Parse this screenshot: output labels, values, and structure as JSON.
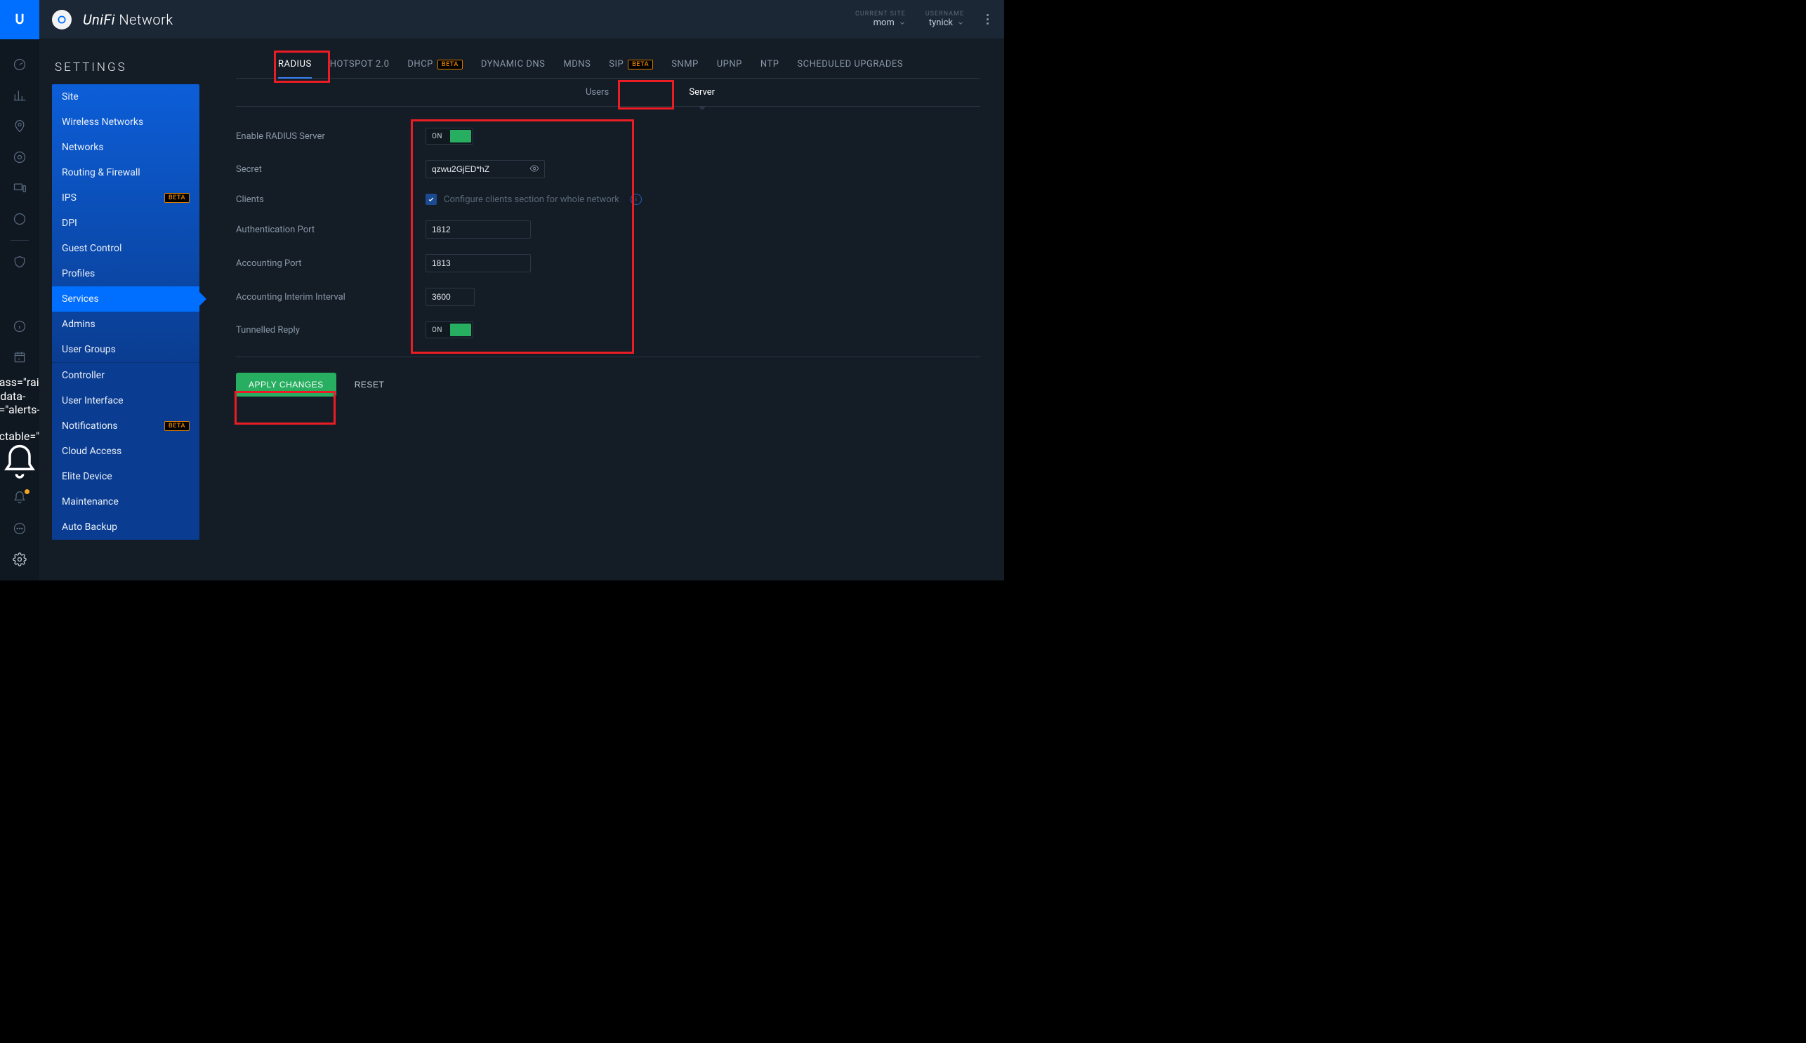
{
  "header": {
    "brand_prefix": "UniFi",
    "brand_suffix": " Network",
    "current_site_label": "CURRENT SITE",
    "current_site_value": "mom",
    "username_label": "USERNAME",
    "username_value": "tynick"
  },
  "sidebar": {
    "title": "SETTINGS",
    "group_top": [
      {
        "label": "Site"
      },
      {
        "label": "Wireless Networks"
      },
      {
        "label": "Networks"
      },
      {
        "label": "Routing & Firewall"
      },
      {
        "label": "IPS",
        "beta": "BETA"
      },
      {
        "label": "DPI"
      },
      {
        "label": "Guest Control"
      },
      {
        "label": "Profiles"
      },
      {
        "label": "Services",
        "active": true
      },
      {
        "label": "Admins"
      },
      {
        "label": "User Groups"
      }
    ],
    "group_bottom": [
      {
        "label": "Controller"
      },
      {
        "label": "User Interface"
      },
      {
        "label": "Notifications",
        "beta": "BETA"
      },
      {
        "label": "Cloud Access"
      },
      {
        "label": "Elite Device"
      },
      {
        "label": "Maintenance"
      },
      {
        "label": "Auto Backup"
      }
    ]
  },
  "tabs": {
    "top": [
      {
        "label": "RADIUS",
        "active": true
      },
      {
        "label": "HOTSPOT 2.0"
      },
      {
        "label": "DHCP",
        "beta": "BETA"
      },
      {
        "label": "DYNAMIC DNS"
      },
      {
        "label": "MDNS"
      },
      {
        "label": "SIP",
        "beta": "BETA"
      },
      {
        "label": "SNMP"
      },
      {
        "label": "UPNP"
      },
      {
        "label": "NTP"
      },
      {
        "label": "SCHEDULED UPGRADES"
      }
    ],
    "sub": [
      {
        "label": "Users"
      },
      {
        "label": "Server",
        "active": true
      }
    ]
  },
  "form": {
    "enable_label": "Enable RADIUS Server",
    "enable_toggle": "ON",
    "secret_label": "Secret",
    "secret_value": "qzwu2GjED*hZ",
    "clients_label": "Clients",
    "clients_checkbox_text": "Configure clients section for whole network",
    "auth_port_label": "Authentication Port",
    "auth_port_value": "1812",
    "acct_port_label": "Accounting Port",
    "acct_port_value": "1813",
    "acct_interval_label": "Accounting Interim Interval",
    "acct_interval_value": "3600",
    "tunnelled_label": "Tunnelled Reply",
    "tunnelled_toggle": "ON"
  },
  "actions": {
    "apply": "APPLY CHANGES",
    "reset": "RESET"
  }
}
